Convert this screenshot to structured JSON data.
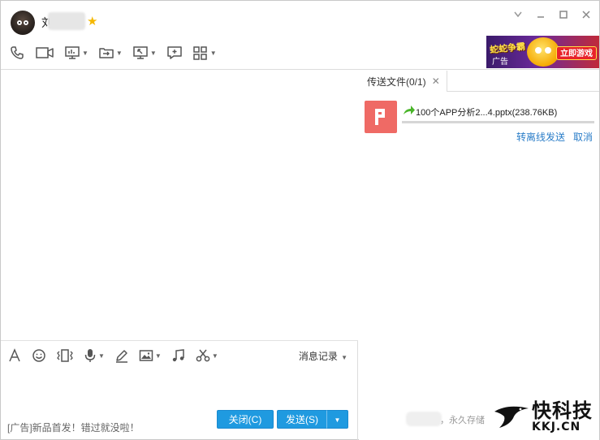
{
  "header": {
    "contact_name": "刘",
    "vip_icon": "star-badge-icon",
    "controls": [
      "chevron-down-icon",
      "minimize-icon",
      "maximize-icon",
      "close-icon"
    ]
  },
  "toolbar": {
    "items": [
      "phone-icon",
      "video-icon",
      "screen-share-icon",
      "file-transfer-icon",
      "remote-desktop-icon",
      "new-chat-icon",
      "apps-grid-icon"
    ]
  },
  "ad_banner": {
    "title": "蛇蛇争霸",
    "label": "广告",
    "play_button": "立即游戏"
  },
  "chat": {
    "input_tools": [
      "font-icon",
      "emoji-icon",
      "shake-icon",
      "voice-icon",
      "pen-icon",
      "image-icon",
      "music-icon",
      "scissors-icon"
    ],
    "history_label": "消息记录",
    "ad_text": "[广告]新品首发！错过就没啦！",
    "close_button": "关闭(C)",
    "send_button": "发送(S)"
  },
  "side": {
    "tab_label": "传送文件(0/1)",
    "file": {
      "name": "100个APP分析2...4.pptx(238.76KB)",
      "progress": 0.0
    },
    "actions": {
      "offline": "转离线发送",
      "cancel": "取消"
    },
    "footer_text": "，永久存储"
  },
  "watermark": {
    "main": "快科技",
    "sub": "KKJ.CN"
  },
  "colors": {
    "accent": "#1f9ae0",
    "link": "#2a7dc8",
    "file_icon": "#ef6a65"
  }
}
